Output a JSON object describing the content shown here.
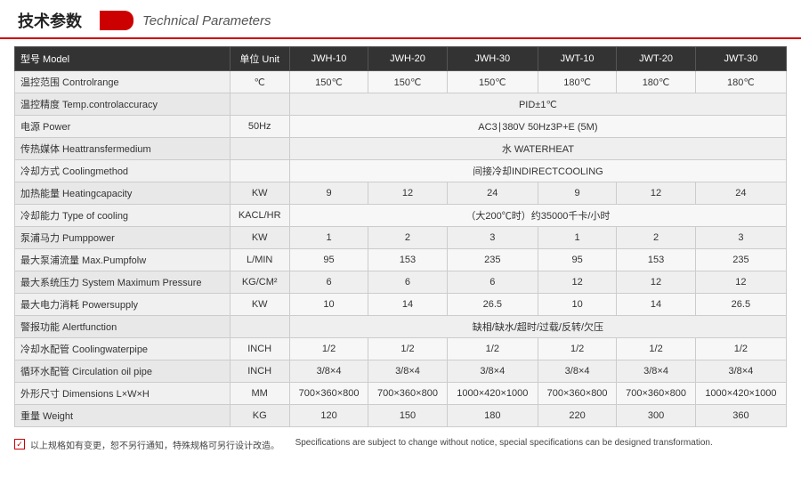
{
  "header": {
    "cn": "技术参数",
    "en": "Technical Parameters"
  },
  "table": {
    "columns": [
      {
        "label": "型号 Model"
      },
      {
        "label": "单位 Unit"
      },
      {
        "label": "JWH-10"
      },
      {
        "label": "JWH-20"
      },
      {
        "label": "JWH-30"
      },
      {
        "label": "JWT-10"
      },
      {
        "label": "JWT-20"
      },
      {
        "label": "JWT-30"
      }
    ],
    "rows": [
      {
        "label": "温控范围 Controlrange",
        "unit": "℃",
        "values": [
          "150℃",
          "150℃",
          "150℃",
          "180℃",
          "180℃",
          "180℃"
        ],
        "span": false
      },
      {
        "label": "温控精度 Temp.controlaccuracy",
        "unit": "",
        "values": [],
        "span": true,
        "spanText": "PID±1℃"
      },
      {
        "label": "电源 Power",
        "unit": "50Hz",
        "values": [],
        "span": true,
        "spanText": "AC3∣380V 50Hz3P+E (5M)"
      },
      {
        "label": "传热媒体 Heattransfermedium",
        "unit": "",
        "values": [],
        "span": true,
        "spanText": "水 WATERHEAT"
      },
      {
        "label": "冷却方式 Coolingmethod",
        "unit": "",
        "values": [],
        "span": true,
        "spanText": "间接冷却INDIRECTCOOLING"
      },
      {
        "label": "加热能量 Heatingcapacity",
        "unit": "KW",
        "values": [
          "9",
          "12",
          "24",
          "9",
          "12",
          "24"
        ],
        "span": false
      },
      {
        "label": "冷却能力 Type of cooling",
        "unit": "KACL/HR",
        "values": [],
        "span": true,
        "spanText": "（大200℃时）约35000千卡/小时"
      },
      {
        "label": "泵浦马力 Pumppower",
        "unit": "KW",
        "values": [
          "1",
          "2",
          "3",
          "1",
          "2",
          "3"
        ],
        "span": false
      },
      {
        "label": "最大泵浦流量 Max.Pumpfolw",
        "unit": "L/MIN",
        "values": [
          "95",
          "153",
          "235",
          "95",
          "153",
          "235"
        ],
        "span": false
      },
      {
        "label": "最大系统压力 System Maximum Pressure",
        "unit": "KG/CM²",
        "values": [
          "6",
          "6",
          "6",
          "12",
          "12",
          "12"
        ],
        "span": false
      },
      {
        "label": "最大电力消耗 Powersupply",
        "unit": "KW",
        "values": [
          "10",
          "14",
          "26.5",
          "10",
          "14",
          "26.5"
        ],
        "span": false
      },
      {
        "label": "警报功能 Alertfunction",
        "unit": "",
        "values": [],
        "span": true,
        "spanText": "缺相/缺水/超时/过载/反转/欠压"
      },
      {
        "label": "冷却水配管 Coolingwaterpipe",
        "unit": "INCH",
        "values": [
          "1/2",
          "1/2",
          "1/2",
          "1/2",
          "1/2",
          "1/2"
        ],
        "span": false
      },
      {
        "label": "循环水配管 Circulation oil pipe",
        "unit": "INCH",
        "values": [
          "3/8×4",
          "3/8×4",
          "3/8×4",
          "3/8×4",
          "3/8×4",
          "3/8×4"
        ],
        "span": false
      },
      {
        "label": "外形尺寸 Dimensions L×W×H",
        "unit": "MM",
        "values": [
          "700×360×800",
          "700×360×800",
          "1000×420×1000",
          "700×360×800",
          "700×360×800",
          "1000×420×1000"
        ],
        "span": false
      },
      {
        "label": "重量 Weight",
        "unit": "KG",
        "values": [
          "120",
          "150",
          "180",
          "220",
          "300",
          "360"
        ],
        "span": false
      }
    ]
  },
  "footer": {
    "cn": "以上规格如有变更，恕不另行通知，特殊规格可另行设计改造。",
    "en": "Specifications are subject to change without notice, special specifications can be designed transformation."
  }
}
